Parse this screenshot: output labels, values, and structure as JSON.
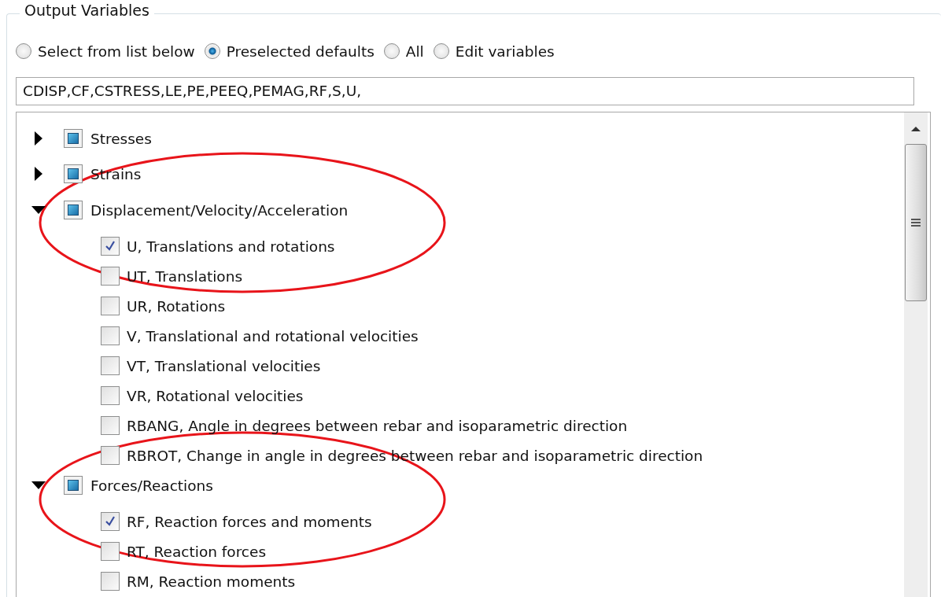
{
  "group_box": {
    "title": "Output Variables"
  },
  "radios": [
    {
      "label": "Select from list below",
      "selected": false
    },
    {
      "label": "Preselected defaults",
      "selected": true
    },
    {
      "label": "All",
      "selected": false
    },
    {
      "label": "Edit variables",
      "selected": false
    }
  ],
  "variables_field": {
    "value": "CDISP,CF,CSTRESS,LE,PE,PEEQ,PEMAG,RF,S,U,"
  },
  "tree": [
    {
      "label": "Stresses",
      "expanded": false,
      "partially_checked": true
    },
    {
      "label": "Strains",
      "expanded": false,
      "partially_checked": true
    },
    {
      "label": "Displacement/Velocity/Acceleration",
      "expanded": true,
      "partially_checked": true,
      "children": [
        {
          "label": "U, Translations and rotations",
          "checked": true
        },
        {
          "label": "UT, Translations",
          "checked": false
        },
        {
          "label": "UR, Rotations",
          "checked": false
        },
        {
          "label": "V, Translational and rotational velocities",
          "checked": false
        },
        {
          "label": "VT, Translational velocities",
          "checked": false
        },
        {
          "label": "VR, Rotational velocities",
          "checked": false
        },
        {
          "label": "RBANG, Angle in degrees between rebar and isoparametric direction",
          "checked": false
        },
        {
          "label": "RBROT, Change in angle in degrees between rebar and isoparametric direction",
          "checked": false
        }
      ]
    },
    {
      "label": "Forces/Reactions",
      "expanded": true,
      "partially_checked": true,
      "children": [
        {
          "label": "RF, Reaction forces and moments",
          "checked": true
        },
        {
          "label": "RT, Reaction forces",
          "checked": false
        },
        {
          "label": "RM, Reaction moments",
          "checked": false
        }
      ]
    }
  ]
}
